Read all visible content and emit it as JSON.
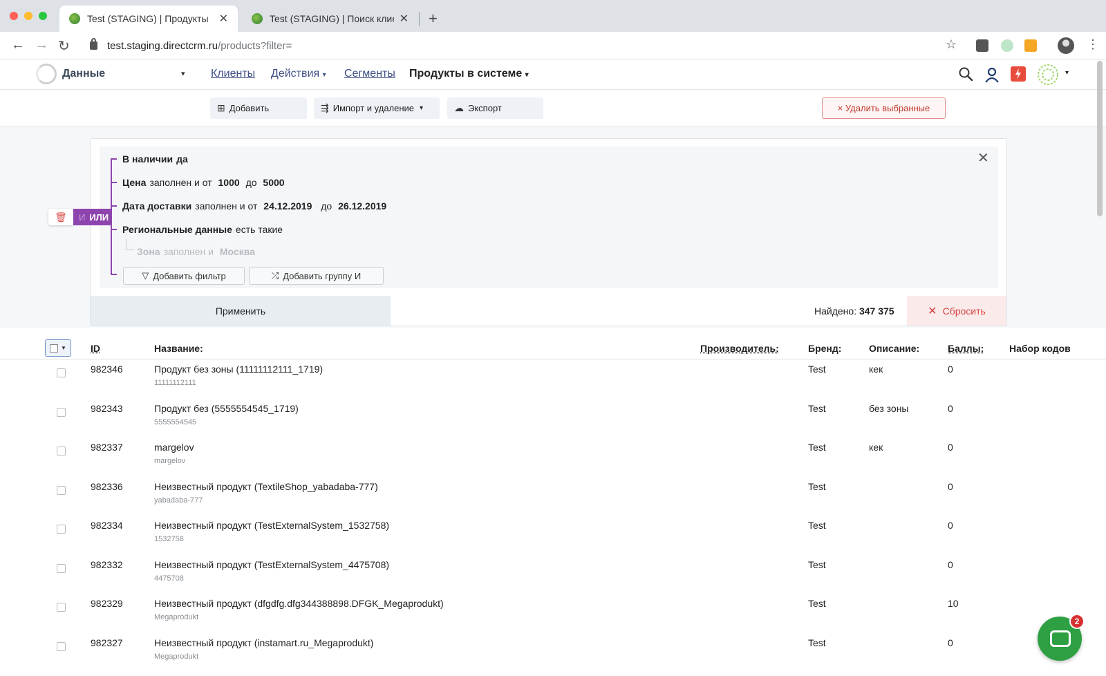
{
  "browser": {
    "tabs": [
      {
        "title": "Test (STAGING) | Продукты",
        "close": "✕"
      },
      {
        "title": "Test (STAGING) | Поиск клиен",
        "close": "✕"
      }
    ],
    "new_tab": "+",
    "url_host": "test.staging.directcrm.ru",
    "url_path": "/products?filter=",
    "icons": {
      "back": "←",
      "forward": "→",
      "reload": "↻",
      "star": "☆",
      "menu": "⋮"
    }
  },
  "header": {
    "section": "Данные",
    "nav": [
      {
        "label": "Клиенты"
      },
      {
        "label": "Действия"
      },
      {
        "label": "Сегменты"
      },
      {
        "label": "Продукты в системе"
      }
    ],
    "caret": "▾"
  },
  "toolbar": {
    "add": "Добавить",
    "import": "Импорт и удаление",
    "export": "Экспорт",
    "delete_selected": "× Удалить выбранные"
  },
  "filter": {
    "rows": [
      {
        "field": "В наличии",
        "rest": "да"
      },
      {
        "field": "Цена",
        "rest": "заполнен и  от",
        "v1": "1000",
        "mid": "до",
        "v2": "5000"
      },
      {
        "field": "Дата доставки",
        "rest": "заполнен и   от",
        "v1": "24.12.2019",
        "mid": "до",
        "v2": "26.12.2019"
      },
      {
        "field": "Региональные данные",
        "rest": "есть такие"
      }
    ],
    "sub_row": {
      "field": "Зона",
      "rest": "заполнен и",
      "value": "Москва"
    },
    "add_filter": "Добавить фильтр",
    "add_group": "Добавить группу И",
    "toggle_and": "И",
    "toggle_or": "ИЛИ",
    "apply": "Применить",
    "found_label": "Найдено:",
    "found_count": "347 375",
    "reset": "Сбросить",
    "close": "✕"
  },
  "table": {
    "columns": [
      "ID",
      "Название:",
      "Производитель:",
      "Бренд:",
      "Описание:",
      "Баллы:",
      "Набор кодов"
    ],
    "rows": [
      {
        "id": "982346",
        "name": "Продукт без зоны (11111112111_1719)",
        "code": "11111112111",
        "brand": "Test",
        "description": "кек",
        "points": "0"
      },
      {
        "id": "982343",
        "name": "Продукт без (5555554545_1719)",
        "code": "5555554545",
        "brand": "Test",
        "description": "без зоны",
        "points": "0"
      },
      {
        "id": "982337",
        "name": "margelov",
        "code": "margelov",
        "brand": "Test",
        "description": "кек",
        "points": "0"
      },
      {
        "id": "982336",
        "name": "Неизвестный продукт (TextileShop_yabadaba-777)",
        "code": "yabadaba-777",
        "brand": "Test",
        "description": "",
        "points": "0"
      },
      {
        "id": "982334",
        "name": "Неизвестный продукт (TestExternalSystem_1532758)",
        "code": "1532758",
        "brand": "Test",
        "description": "",
        "points": "0"
      },
      {
        "id": "982332",
        "name": "Неизвестный продукт (TestExternalSystem_4475708)",
        "code": "4475708",
        "brand": "Test",
        "description": "",
        "points": "0"
      },
      {
        "id": "982329",
        "name": "Неизвестный продукт (dfgdfg.dfg344388898.DFGK_Megaprodukt)",
        "code": "Megaprodukt",
        "brand": "Test",
        "description": "",
        "points": "10"
      },
      {
        "id": "982327",
        "name": "Неизвестный продукт (instamart.ru_Megaprodukt)",
        "code": "Megaprodukt",
        "brand": "Test",
        "description": "",
        "points": "0"
      }
    ]
  },
  "chat": {
    "badge": "2"
  },
  "colors": {
    "accent_purple": "#8e44ad",
    "danger": "#d64541",
    "chat_green": "#2ea043"
  }
}
